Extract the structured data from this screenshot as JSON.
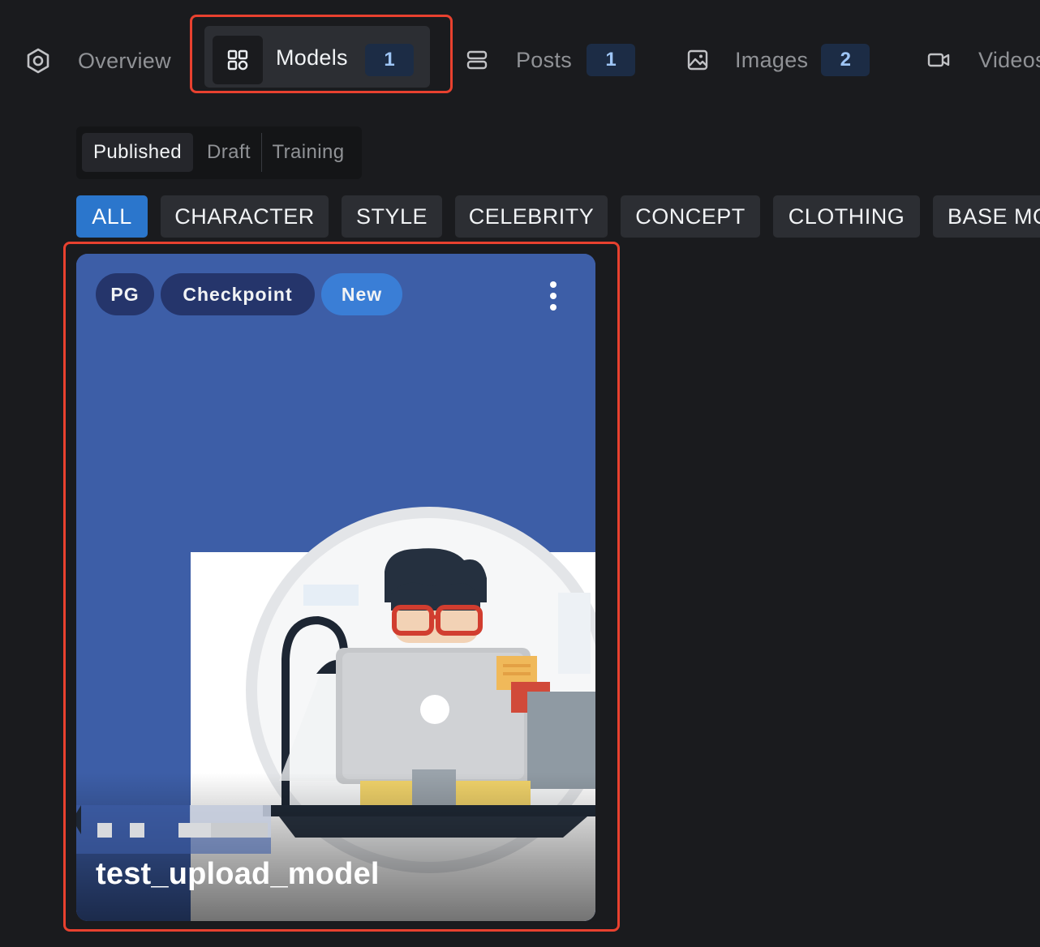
{
  "tabs": {
    "overview": {
      "label": "Overview",
      "icon": "hexagon-icon"
    },
    "models": {
      "label": "Models",
      "count": "1",
      "icon": "grid-icon"
    },
    "posts": {
      "label": "Posts",
      "count": "1",
      "icon": "stack-icon"
    },
    "images": {
      "label": "Images",
      "count": "2",
      "icon": "image-icon"
    },
    "videos": {
      "label": "Videos",
      "icon": "video-icon"
    }
  },
  "segmented": {
    "options": [
      "Published",
      "Draft",
      "Training"
    ],
    "selected": "Published"
  },
  "categories": {
    "items": [
      "ALL",
      "CHARACTER",
      "STYLE",
      "CELEBRITY",
      "CONCEPT",
      "CLOTHING",
      "BASE MODEL"
    ],
    "selected": "ALL"
  },
  "card": {
    "badges": {
      "rating": "PG",
      "type": "Checkpoint",
      "status": "New"
    },
    "title": "test_upload_model",
    "menu_icon": "dots-vertical-icon"
  },
  "colors": {
    "background": "#1a1b1e",
    "accent": "#2b76cc",
    "highlight": "#e8412f",
    "card_bg": "#3d5ea7",
    "count_bg": "#1c2c45",
    "count_text": "#9ec5f5"
  }
}
